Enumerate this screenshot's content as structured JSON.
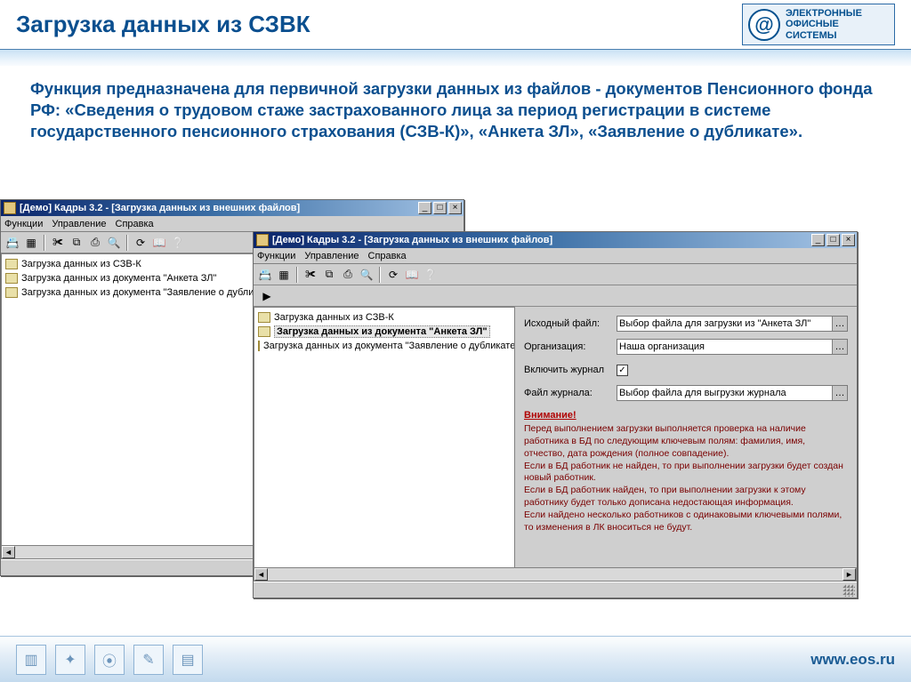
{
  "header": {
    "title": "Загрузка данных из СЗВК",
    "logo_line1": "ЭЛЕКТРОННЫЕ",
    "logo_line2": "ОФИСНЫЕ",
    "logo_line3": "СИСТЕМЫ"
  },
  "intro": "Функция предназначена для первичной загрузки данных из файлов - документов Пенсионного фонда РФ:  «Сведения о трудовом стаже застрахованного лица за период регистрации в системе государственного пенсионного страхования (СЗВ-К)», «Анкета ЗЛ», «Заявление о дубликате».",
  "win_common": {
    "title": "[Демо] Кадры 3.2 - [Загрузка данных из внешних файлов]",
    "menu": [
      "Функции",
      "Управление",
      "Справка"
    ]
  },
  "tree_items": [
    "Загрузка данных из СЗВ-К",
    "Загрузка данных из документа \"Анкета ЗЛ\"",
    "Загрузка данных из документа \"Заявление о дубликате\""
  ],
  "front_win": {
    "selected_index": 1,
    "form": {
      "source_label": "Исходный файл:",
      "source_value": "Выбор файла для загрузки из \"Анкета ЗЛ\"",
      "org_label": "Организация:",
      "org_value": "Наша организация",
      "journal_toggle_label": "Включить журнал",
      "journal_toggle_checked": "✓",
      "journal_file_label": "Файл журнала:",
      "journal_file_value": "Выбор файла для выгрузки журнала"
    },
    "warning_head": "Внимание!",
    "warning_body": "    Перед выполнением загрузки выполняется проверка на наличие работника в БД по следующим ключевым полям: фамилия, имя, отчество, дата рождения (полное совпадение).\n    Если в БД работник не найден, то при выполнении загрузки будет создан новый работник.\n    Если в БД работник найден, то при выполнении загрузки к этому работнику будет только дописана недостающая информация.\n    Если найдено несколько работников с одинаковыми ключевыми полями, то изменения в ЛК вноситься не будут."
  },
  "footer": {
    "url": "www.eos.ru"
  }
}
